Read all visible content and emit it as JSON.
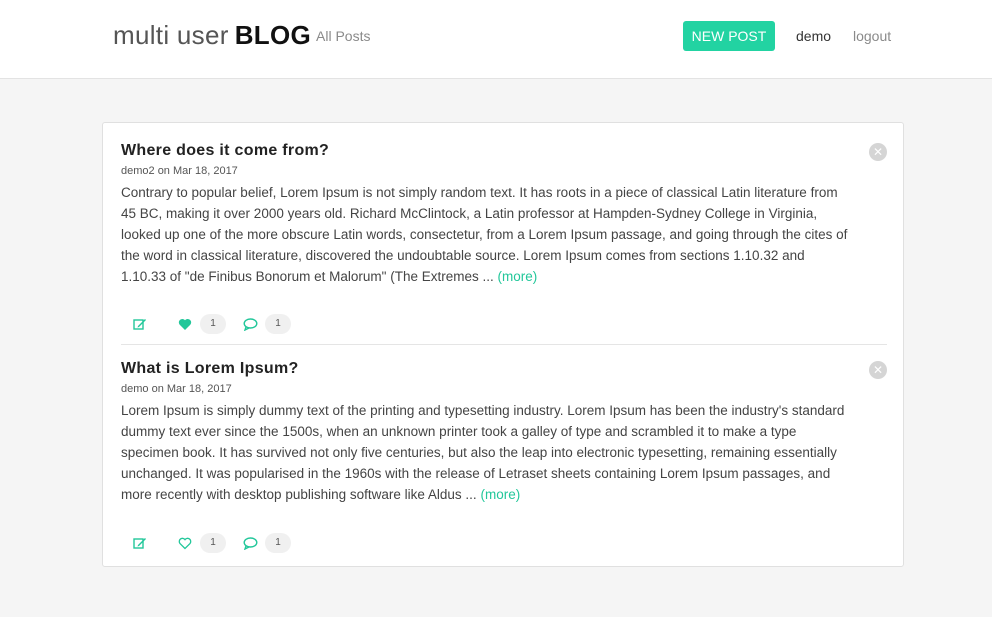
{
  "header": {
    "brand_light": "multi user",
    "brand_bold": "BLOG",
    "all_posts": "All Posts",
    "new_post": "NEW POST",
    "username": "demo",
    "logout": "logout"
  },
  "colors": {
    "accent": "#22d3a2",
    "link": "#22c79a"
  },
  "posts": [
    {
      "title": "Where does it come from?",
      "meta": "demo2 on Mar 18, 2017",
      "body": "Contrary to popular belief, Lorem Ipsum is not simply random text. It has roots in a piece of classical Latin literature from 45 BC, making it over 2000 years old. Richard McClintock, a Latin professor at Hampden-Sydney College in Virginia, looked up one of the more obscure Latin words, consectetur, from a Lorem Ipsum passage, and going through the cites of the word in classical literature, discovered the undoubtable source. Lorem Ipsum comes from sections 1.10.32 and 1.10.33 of \"de Finibus Bonorum et Malorum\" (The Extremes ...",
      "more": "(more)",
      "likes": "1",
      "comments": "1",
      "liked": true,
      "icons": {
        "close": "close-circle-icon",
        "edit": "edit-icon",
        "like": "heart-filled-icon",
        "comment": "comment-icon"
      }
    },
    {
      "title": "What is Lorem Ipsum?",
      "meta": "demo on Mar 18, 2017",
      "body": "Lorem Ipsum is simply dummy text of the printing and typesetting industry. Lorem Ipsum has been the industry's standard dummy text ever since the 1500s, when an unknown printer took a galley of type and scrambled it to make a type specimen book. It has survived not only five centuries, but also the leap into electronic typesetting, remaining essentially unchanged. It was popularised in the 1960s with the release of Letraset sheets containing Lorem Ipsum passages, and more recently with desktop publishing software like Aldus ...",
      "more": "(more)",
      "likes": "1",
      "comments": "1",
      "liked": false,
      "icons": {
        "close": "close-circle-icon",
        "edit": "edit-icon",
        "like": "heart-outline-icon",
        "comment": "comment-icon"
      }
    }
  ]
}
